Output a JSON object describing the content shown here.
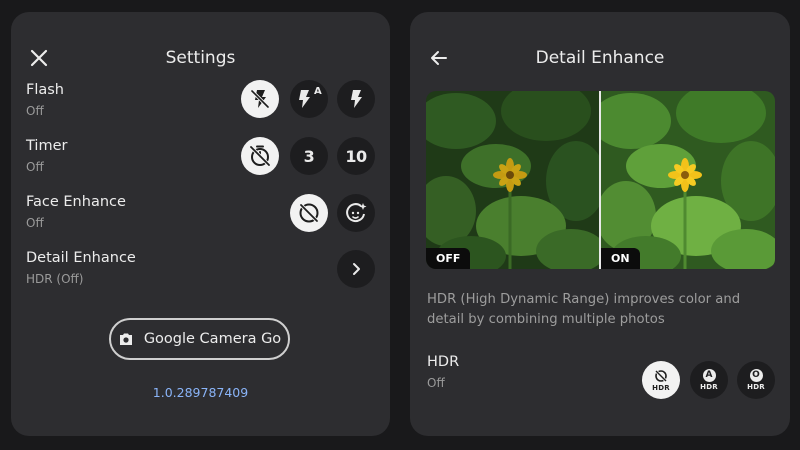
{
  "settings": {
    "title": "Settings",
    "flash": {
      "label": "Flash",
      "value": "Off",
      "auto_glyph": "A"
    },
    "timer": {
      "label": "Timer",
      "value": "Off",
      "opt_3": "3",
      "opt_10": "10"
    },
    "face_enhance": {
      "label": "Face Enhance",
      "value": "Off"
    },
    "detail_enhance": {
      "label": "Detail Enhance",
      "value": "HDR (Off)"
    },
    "app_button_label": "Google Camera Go",
    "version": "1.0.289787409"
  },
  "detail": {
    "title": "Detail Enhance",
    "tag_off": "OFF",
    "tag_on": "ON",
    "description": "HDR (High Dynamic Range) improves color and detail by combining multiple photos",
    "hdr": {
      "label": "HDR",
      "value": "Off",
      "option_text": "HDR",
      "auto_glyph": "A",
      "on_glyph": "O"
    }
  },
  "colors": {
    "background": "#19191b",
    "panel": "#2d2d30",
    "selected_option": "#f2f2f2",
    "unselected_option": "#1d1d1f",
    "version_link": "#8ab4f8"
  }
}
